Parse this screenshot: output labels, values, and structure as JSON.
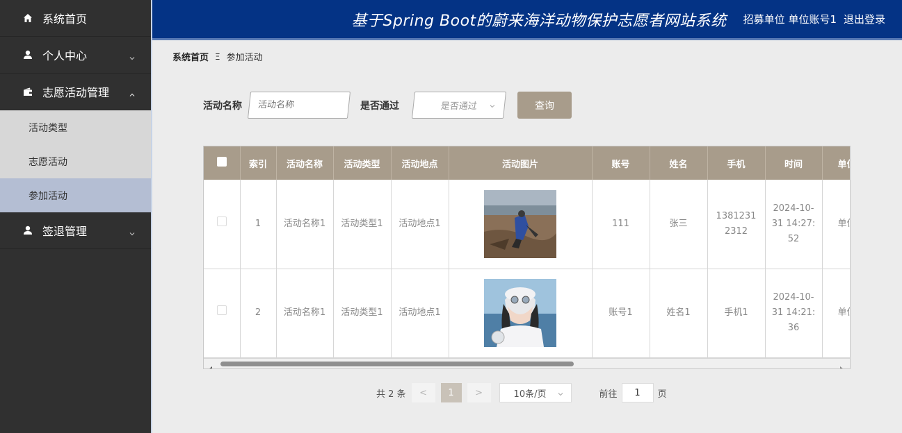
{
  "header": {
    "title": "基于Spring Boot的蔚来海洋动物保护志愿者网站系统",
    "user": "招募单位 单位账号1",
    "logout": "退出登录"
  },
  "sidebar": {
    "items": [
      {
        "label": "系统首页",
        "icon": "home-icon"
      },
      {
        "label": "个人中心",
        "icon": "user-icon",
        "chevron": "down"
      },
      {
        "label": "志愿活动管理",
        "icon": "wallet-icon",
        "chevron": "up"
      },
      {
        "label": "签退管理",
        "icon": "user-icon",
        "chevron": "down"
      }
    ],
    "sub_items": [
      {
        "label": "活动类型"
      },
      {
        "label": "志愿活动"
      },
      {
        "label": "参加活动",
        "active": true
      }
    ]
  },
  "breadcrumb": {
    "home": "系统首页",
    "separator": "Ξ",
    "current": "参加活动"
  },
  "search": {
    "name_label": "活动名称",
    "name_placeholder": "活动名称",
    "pass_label": "是否通过",
    "pass_placeholder": "是否通过",
    "query_label": "查询"
  },
  "table": {
    "columns": [
      "索引",
      "活动名称",
      "活动类型",
      "活动地点",
      "活动图片",
      "账号",
      "姓名",
      "手机",
      "时间",
      "单位"
    ],
    "rows": [
      {
        "index": "1",
        "name": "活动名称1",
        "type": "活动类型1",
        "place": "活动地点1",
        "account": "111",
        "person": "张三",
        "phone": "13812312312",
        "time": "2024-10-31 14:27:52",
        "unit": "单位"
      },
      {
        "index": "2",
        "name": "活动名称1",
        "type": "活动类型1",
        "place": "活动地点1",
        "account": "账号1",
        "person": "姓名1",
        "phone": "手机1",
        "time": "2024-10-31 14:21:36",
        "unit": "单位"
      }
    ]
  },
  "pagination": {
    "total": "共 2 条",
    "prev": "<",
    "current": "1",
    "next": ">",
    "page_size": "10条/页",
    "goto_label": "前往",
    "goto_value": "1",
    "page_suffix": "页"
  },
  "colors": {
    "header_bg": "#043385",
    "sidebar_bg": "#303030",
    "accent": "#a89c8b"
  }
}
